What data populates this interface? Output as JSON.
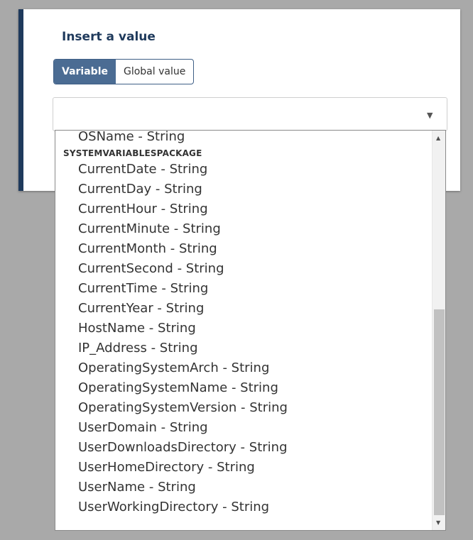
{
  "dialog": {
    "title": "Insert a value",
    "tabs": [
      {
        "label": "Variable",
        "active": true
      },
      {
        "label": "Global value",
        "active": false
      }
    ],
    "select": {
      "value": ""
    }
  },
  "dropdown": {
    "items": [
      {
        "label": "OSName - String"
      },
      {
        "group": "SYSTEMVARIABLESPACKAGE"
      },
      {
        "label": "CurrentDate - String"
      },
      {
        "label": "CurrentDay - String"
      },
      {
        "label": "CurrentHour - String"
      },
      {
        "label": "CurrentMinute - String"
      },
      {
        "label": "CurrentMonth - String"
      },
      {
        "label": "CurrentSecond - String"
      },
      {
        "label": "CurrentTime - String"
      },
      {
        "label": "CurrentYear - String"
      },
      {
        "label": "HostName - String"
      },
      {
        "label": "IP_Address - String"
      },
      {
        "label": "OperatingSystemArch - String"
      },
      {
        "label": "OperatingSystemName - String"
      },
      {
        "label": "OperatingSystemVersion - String"
      },
      {
        "label": "UserDomain - String"
      },
      {
        "label": "UserDownloadsDirectory - String"
      },
      {
        "label": "UserHomeDirectory - String"
      },
      {
        "label": "UserName - String"
      },
      {
        "label": "UserWorkingDirectory - String"
      }
    ],
    "scroll_position": 0.98
  },
  "colors": {
    "accent": "#1f3a5c",
    "tab_active": "#4b6c93",
    "overlay": "#a9a9a9"
  },
  "icons": {
    "select_chevron": "chevron-down-icon",
    "scroll_up": "scroll-up-arrow-icon",
    "scroll_down": "scroll-down-arrow-icon"
  }
}
